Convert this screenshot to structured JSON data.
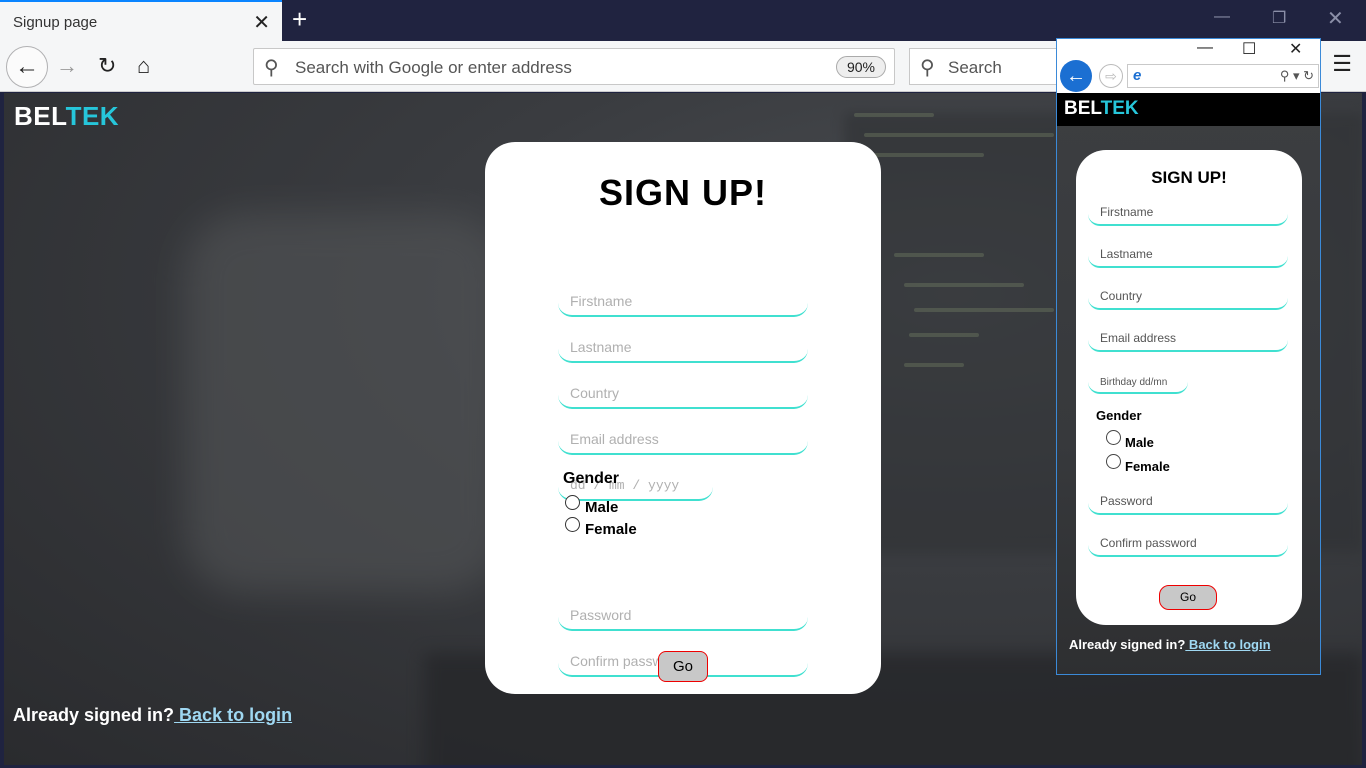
{
  "browser": {
    "tab_title": "Signup page",
    "tab_close": "✕",
    "new_tab": "+",
    "url_placeholder": "Search with Google or enter address",
    "zoom": "90%",
    "search_placeholder": "Search",
    "accent": "#0a84ff"
  },
  "page": {
    "logo_part1": "BEL",
    "logo_part2": "TEK",
    "logo_accent_color": "#26c6da",
    "title": "SIGN UP!",
    "fields": {
      "firstname": "Firstname",
      "lastname": "Lastname",
      "country": "Country",
      "email": "Email address",
      "birthday": "dd / mm / yyyy",
      "password": "Password",
      "confirm_password": "Confirm password"
    },
    "gender_label": "Gender",
    "gender_options": [
      "Male",
      "Female"
    ],
    "go_label": "Go",
    "already_text": "Already signed in?",
    "back_link": " Back to login",
    "field_border_color": "#40e0d0",
    "go_border_color": "#ee0000"
  },
  "ie_window": {
    "logo_part1": "BEL",
    "logo_part2": "TEK",
    "title": "SIGN UP!",
    "fields": {
      "firstname": "Firstname",
      "lastname": "Lastname",
      "country": "Country",
      "email": "Email address",
      "birthday": "Birthday dd/mn",
      "password": "Password",
      "confirm_password": "Confirm password"
    },
    "gender_label": "Gender",
    "gender_options": [
      "Male",
      "Female"
    ],
    "go_label": "Go",
    "already_text": "Already signed in?",
    "back_link": " Back to login"
  }
}
